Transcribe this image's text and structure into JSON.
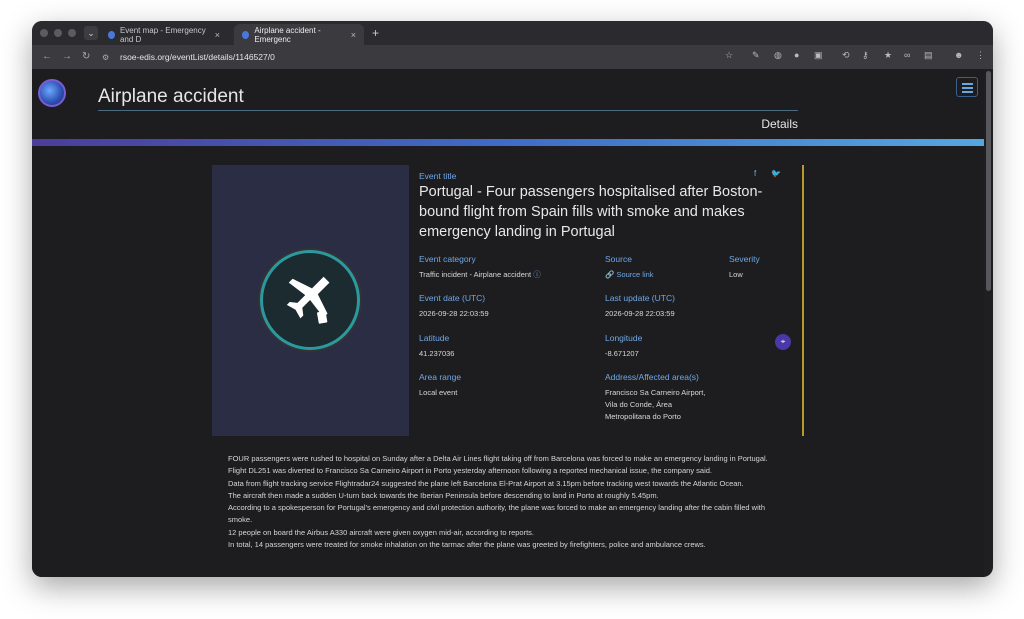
{
  "browser": {
    "tabs": [
      {
        "title": "Event map - Emergency and D"
      },
      {
        "title": "Airplane accident - Emergenc"
      }
    ],
    "url": "rsoe-edis.org/eventList/details/1146527/0"
  },
  "header": {
    "site_title": "Airplane accident",
    "breadcrumb": "Details"
  },
  "event": {
    "title_label": "Event title",
    "title": "Portugal - Four passengers hospitalised after Boston-bound flight from Spain fills with smoke and makes emergency landing in Portugal",
    "category_label": "Event category",
    "category": "Traffic incident - Airplane accident",
    "source_label": "Source",
    "source": "Source link",
    "severity_label": "Severity",
    "severity": "Low",
    "date_label": "Event date (UTC)",
    "date": "2026-09-28 22:03:59",
    "update_label": "Last update (UTC)",
    "update": "2026-09-28 22:03:59",
    "lat_label": "Latitude",
    "lat": "41.237036",
    "lon_label": "Longitude",
    "lon": "-8.671207",
    "area_label": "Area range",
    "area": "Local event",
    "address_label": "Address/Affected area(s)",
    "address_lines": [
      "Francisco Sa Carneiro Airport,",
      "Vila do Conde, Área",
      "Metropolitana do Porto"
    ]
  },
  "article": [
    "FOUR passengers were rushed to hospital on Sunday after a Delta Air Lines flight taking off from Barcelona was forced to make an emergency landing in Portugal.",
    "Flight DL251 was diverted to Francisco Sa Carneiro Airport in Porto yesterday afternoon following a reported mechanical issue, the company said.",
    "Data from flight tracking service Flightradar24 suggested the plane left Barcelona El-Prat Airport at 3.15pm before tracking west towards the Atlantic Ocean.",
    "The aircraft then made a sudden U-turn back towards the Iberian Peninsula before descending to land in Porto at roughly 5.45pm.",
    "According to a spokesperson for Portugal's emergency and civil protection authority, the plane was forced to make an emergency landing after the cabin filled with smoke.",
    "12 people on board the Airbus A330 aircraft were given oxygen mid-air, according to reports.",
    "In total, 14 passengers were treated for smoke inhalation on the tarmac after the plane was greeted by firefighters, police and ambulance crews."
  ],
  "icons": {
    "logo": "globe-logo",
    "event": "airplane-icon",
    "menu": "hamburger-icon",
    "map": "map-marker-icon"
  }
}
